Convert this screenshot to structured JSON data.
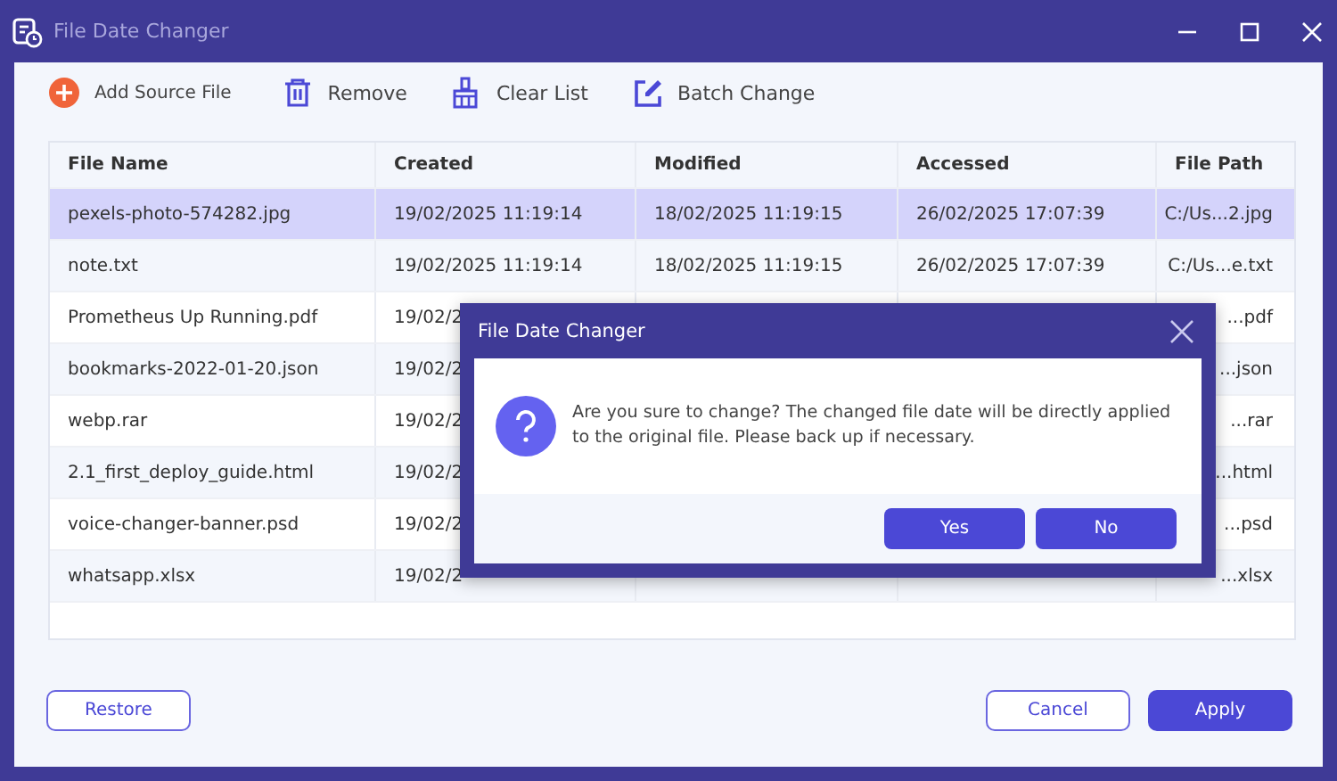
{
  "window": {
    "title": "File Date Changer"
  },
  "toolbar": [
    {
      "label": "Add Source File",
      "kind": "add"
    },
    {
      "label": "Remove",
      "kind": "remove"
    },
    {
      "label": "Clear List",
      "kind": "clear"
    },
    {
      "label": "Batch Change",
      "kind": "batch"
    }
  ],
  "table": {
    "columns": [
      "File Name",
      "Created",
      "Modified",
      "Accessed",
      "File Path"
    ],
    "rows": [
      {
        "selected": true,
        "kind": "full",
        "cells": [
          "pexels-photo-574282.jpg",
          "19/02/2025 11:19:14",
          "18/02/2025 11:19:15",
          "26/02/2025 17:07:39",
          "C:/Us...2.jpg"
        ]
      },
      {
        "selected": false,
        "kind": "full",
        "cells": [
          "note.txt",
          "19/02/2025 11:19:14",
          "18/02/2025 11:19:15",
          "26/02/2025 17:07:39",
          "C:/Us...e.txt"
        ]
      },
      {
        "selected": false,
        "kind": "covered",
        "cells": [
          "Prometheus Up Running.pdf",
          "19/02/2",
          "...pdf"
        ]
      },
      {
        "selected": false,
        "kind": "covered",
        "cells": [
          "bookmarks-2022-01-20.json",
          "19/02/2",
          "...json"
        ]
      },
      {
        "selected": false,
        "kind": "covered",
        "cells": [
          "webp.rar",
          "19/02/2",
          "...rar"
        ]
      },
      {
        "selected": false,
        "kind": "covered",
        "cells": [
          "2.1_first_deploy_guide.html",
          "19/02/2",
          "...html"
        ]
      },
      {
        "selected": false,
        "kind": "covered",
        "cells": [
          "voice-changer-banner.psd",
          "19/02/2",
          "...psd"
        ]
      },
      {
        "selected": false,
        "kind": "covered",
        "cells": [
          "whatsapp.xlsx",
          "19/02/2",
          "...xlsx"
        ]
      }
    ]
  },
  "footer_buttons": [
    {
      "label": "Restore",
      "kind": "outline"
    },
    {
      "label": "Cancel",
      "kind": "outline"
    },
    {
      "label": "Apply",
      "kind": "primary"
    }
  ],
  "dialog": {
    "title": "File Date Changer",
    "message": "Are you sure to change? The changed file date will be directly applied to the original file. Please back up if necessary.",
    "buttons": [
      "Yes",
      "No"
    ]
  }
}
